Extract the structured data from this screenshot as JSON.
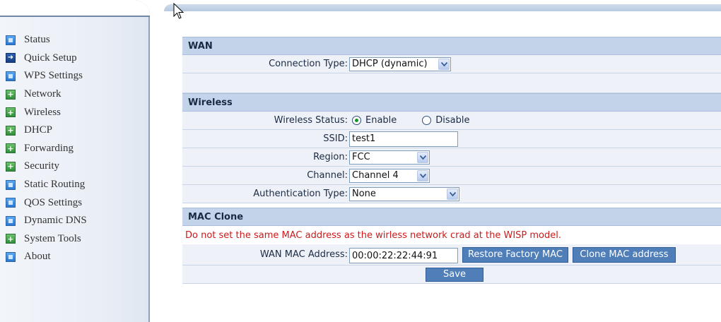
{
  "sidebar": {
    "items": [
      {
        "label": "Status",
        "icon": "square"
      },
      {
        "label": "Quick Setup",
        "icon": "arrow"
      },
      {
        "label": "WPS Settings",
        "icon": "square"
      },
      {
        "label": "Network",
        "icon": "plus"
      },
      {
        "label": "Wireless",
        "icon": "plus"
      },
      {
        "label": "DHCP",
        "icon": "plus"
      },
      {
        "label": "Forwarding",
        "icon": "plus"
      },
      {
        "label": "Security",
        "icon": "plus"
      },
      {
        "label": "Static Routing",
        "icon": "square"
      },
      {
        "label": "QOS Settings",
        "icon": "square"
      },
      {
        "label": "Dynamic DNS",
        "icon": "square"
      },
      {
        "label": "System Tools",
        "icon": "plus"
      },
      {
        "label": "About",
        "icon": "square"
      }
    ]
  },
  "wan": {
    "title": "WAN",
    "connection_type_label": "Connection Type:",
    "connection_type_value": "DHCP (dynamic)"
  },
  "wireless": {
    "title": "Wireless",
    "status_label": "Wireless Status:",
    "enable_label": "Enable",
    "disable_label": "Disable",
    "status_selected": "Enable",
    "ssid_label": "SSID:",
    "ssid_value": "test1",
    "region_label": "Region:",
    "region_value": "FCC",
    "channel_label": "Channel:",
    "channel_value": "Channel 4",
    "auth_label": "Authentication Type:",
    "auth_value": "None"
  },
  "mac_clone": {
    "title": "MAC Clone",
    "warning": "Do not set the same MAC address as the wirless network crad at the WISP model.",
    "wan_mac_label": "WAN MAC Address:",
    "wan_mac_value": "00:00:22:22:44:91",
    "restore_button": "Restore Factory MAC",
    "clone_button": "Clone MAC address",
    "save_button": "Save"
  },
  "colors": {
    "section_header": "#c3d4ea",
    "row_bg": "#eef2f8",
    "button": "#4f7eb8",
    "warning_text": "#cc1a1a"
  }
}
